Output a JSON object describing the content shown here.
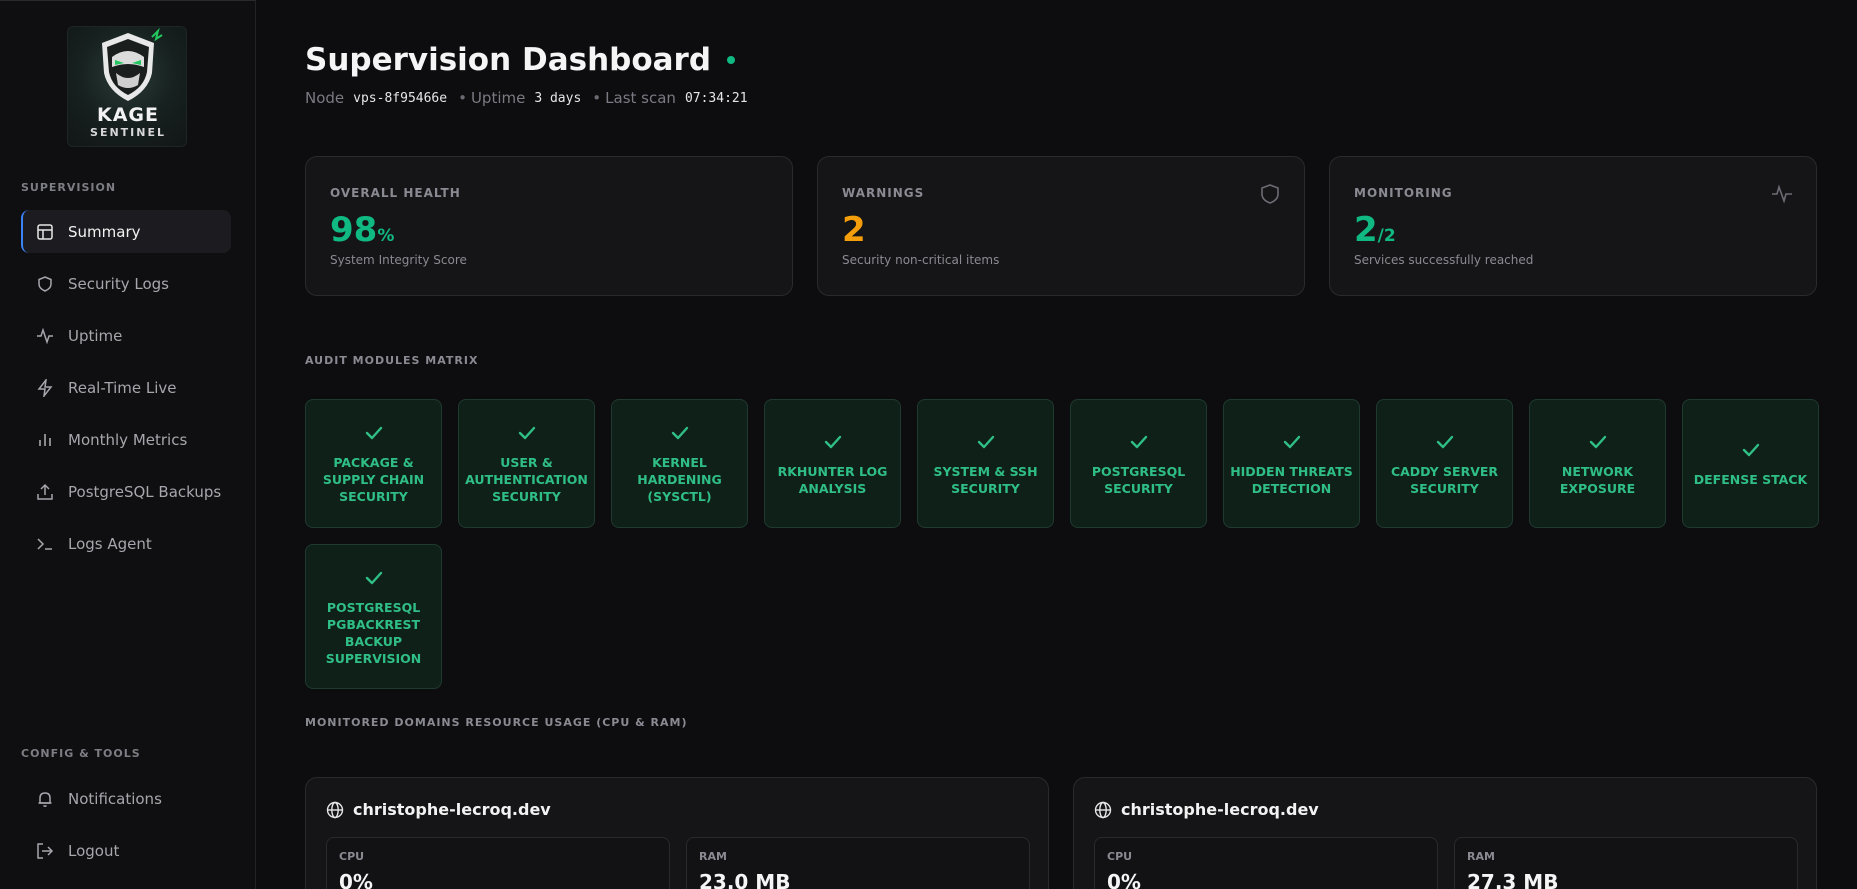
{
  "brand": {
    "line1": "KAGE",
    "line2": "SENTINEL"
  },
  "sidebar": {
    "section_supervision": "SUPERVISION",
    "items": [
      {
        "label": "Summary",
        "icon": "layout-icon",
        "active": true
      },
      {
        "label": "Security Logs",
        "icon": "shield-icon"
      },
      {
        "label": "Uptime",
        "icon": "activity-icon"
      },
      {
        "label": "Real-Time Live",
        "icon": "lightning-icon"
      },
      {
        "label": "Monthly Metrics",
        "icon": "bar-chart-icon"
      },
      {
        "label": "PostgreSQL Backups",
        "icon": "upload-icon"
      },
      {
        "label": "Logs Agent",
        "icon": "terminal-icon"
      }
    ],
    "section_config": "CONFIG & TOOLS",
    "config_items": [
      {
        "label": "Notifications",
        "icon": "bell-icon"
      },
      {
        "label": "Logout",
        "icon": "logout-icon"
      }
    ]
  },
  "header": {
    "title": "Supervision Dashboard",
    "node_label": "Node",
    "node_value": "vps-8f95466e",
    "uptime_label": "Uptime",
    "uptime_value": "3 days",
    "scan_label": "Last scan",
    "scan_value": "07:34:21",
    "separator": "•"
  },
  "cards": [
    {
      "label": "OVERALL HEALTH",
      "value": "98",
      "suffix": "%",
      "desc": "System Integrity Score",
      "color": "#10b981",
      "icon": ""
    },
    {
      "label": "WARNINGS",
      "value": "2",
      "suffix": "",
      "desc": "Security non-critical items",
      "color": "#f59e0b",
      "icon": "shield-icon"
    },
    {
      "label": "MONITORING",
      "value": "2",
      "suffix": "/2",
      "desc": "Services successfully reached",
      "color": "#10b981",
      "icon": "activity-icon"
    }
  ],
  "audit": {
    "title": "AUDIT MODULES MATRIX",
    "modules": [
      "PACKAGE & SUPPLY CHAIN SECURITY",
      "USER & AUTHENTICATION SECURITY",
      "KERNEL HARDENING (SYSCTL)",
      "RKHUNTER LOG ANALYSIS",
      "SYSTEM & SSH SECURITY",
      "POSTGRESQL SECURITY",
      "HIDDEN THREATS DETECTION",
      "CADDY SERVER SECURITY",
      "NETWORK EXPOSURE",
      "DEFENSE STACK",
      "POSTGRESQL PGBACKREST BACKUP SUPERVISION"
    ]
  },
  "domains": {
    "title": "MONITORED DOMAINS RESOURCE USAGE (CPU & RAM)",
    "items": [
      {
        "name": "christophe-lecroq.dev",
        "cpu_label": "CPU",
        "cpu": "0%",
        "ram_label": "RAM",
        "ram": "23.0 MB"
      },
      {
        "name": "christophe-lecroq.dev",
        "cpu_label": "CPU",
        "cpu": "0%",
        "ram_label": "RAM",
        "ram": "27.3 MB"
      }
    ]
  },
  "colors": {
    "accent_green": "#10b981",
    "warning": "#f59e0b",
    "active_border": "#3b82f6"
  }
}
